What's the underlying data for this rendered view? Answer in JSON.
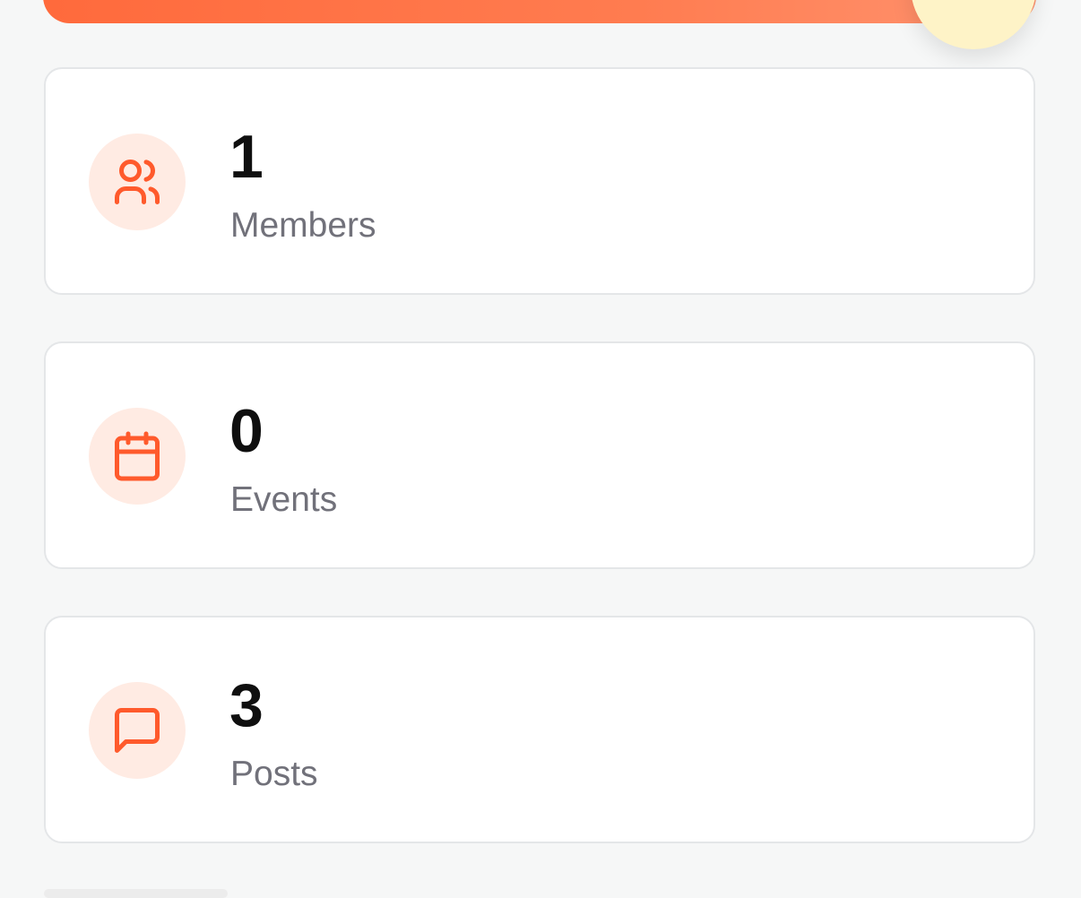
{
  "stats": [
    {
      "value": "1",
      "label": "Members",
      "icon": "users-icon"
    },
    {
      "value": "0",
      "label": "Events",
      "icon": "calendar-icon"
    },
    {
      "value": "3",
      "label": "Posts",
      "icon": "message-square-icon"
    }
  ],
  "colors": {
    "accent": "#ff5a2c",
    "icon_bg": "#ffebe3",
    "fab_bg": "#fef3c7",
    "fab_icon": "#b45309",
    "label": "#71717a"
  }
}
